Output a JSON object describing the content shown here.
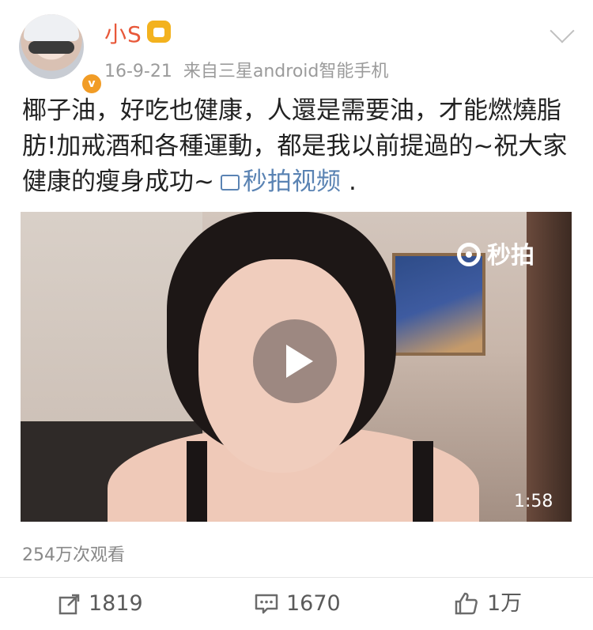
{
  "header": {
    "username": "小S",
    "timestamp": "16-9-21",
    "source": "来自三星android智能手机",
    "verified_badge": "v"
  },
  "post": {
    "text": "椰子油，好吃也健康，人還是需要油，才能燃燒脂肪!加戒酒和各種運動，都是我以前提過的~祝大家健康的瘦身成功~",
    "video_link": "秒拍视频",
    "trailing": "."
  },
  "video": {
    "watermark": "秒拍",
    "duration": "1:58"
  },
  "views": "254万次观看",
  "actions": {
    "repost_count": "1819",
    "comment_count": "1670",
    "like_count": "1万"
  },
  "colors": {
    "username": "#e8583a",
    "link": "#5a83b3",
    "meta": "#9b9b9b"
  },
  "icons": {
    "repost": "share-icon",
    "comment": "comment-icon",
    "like": "thumbs-up-icon"
  }
}
